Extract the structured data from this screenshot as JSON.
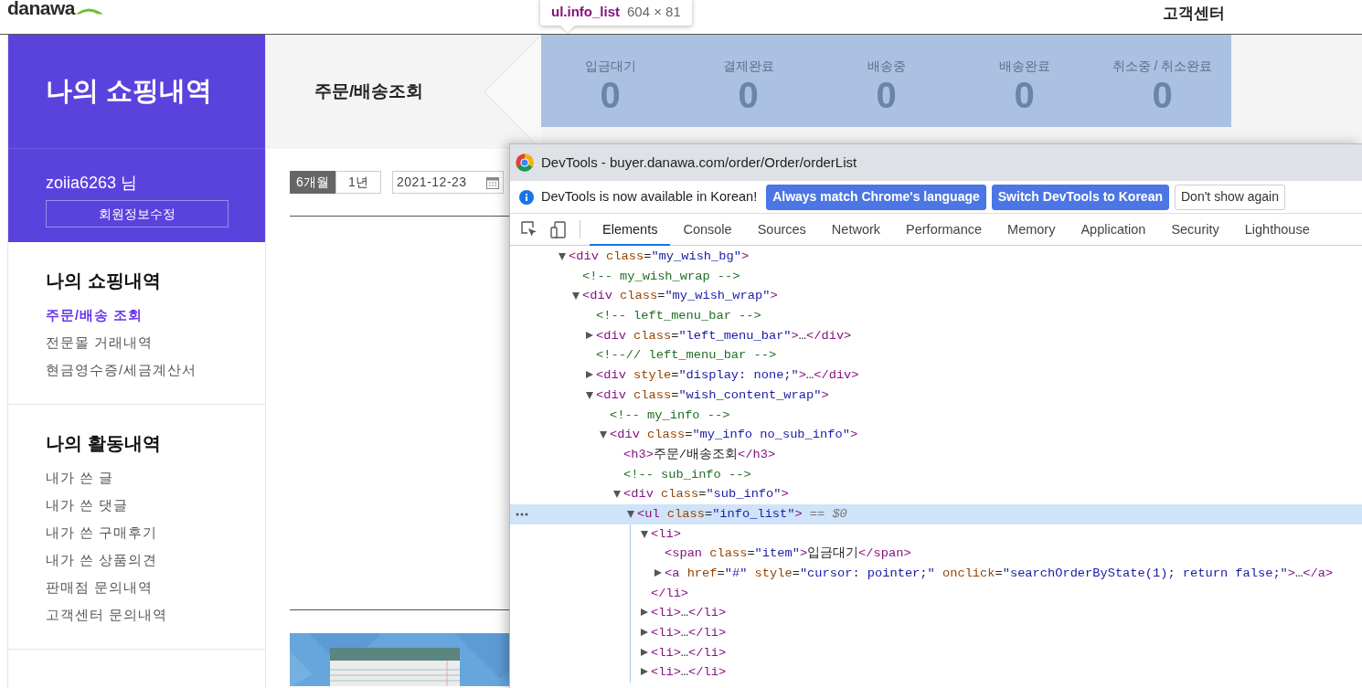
{
  "header": {
    "logo": "danawa",
    "link": "고객센터"
  },
  "tooltip": {
    "selector": "ul.info_list",
    "size": "604 × 81"
  },
  "sidebar": {
    "title": "나의 쇼핑내역",
    "user": "zoiia6263 님",
    "edit_button": "회원정보수정",
    "sections": [
      {
        "heading": "나의 쇼핑내역",
        "items": [
          {
            "label": "주문/배송 조회",
            "selected": true
          },
          {
            "label": "전문몰 거래내역",
            "selected": false
          },
          {
            "label": "현금영수증/세금계산서",
            "selected": false
          }
        ]
      },
      {
        "heading": "나의 활동내역",
        "items": [
          {
            "label": "내가 쓴 글",
            "selected": false
          },
          {
            "label": "내가 쓴 댓글",
            "selected": false
          },
          {
            "label": "내가 쓴 구매후기",
            "selected": false
          },
          {
            "label": "내가 쓴 상품의견",
            "selected": false
          },
          {
            "label": "판매점 문의내역",
            "selected": false
          },
          {
            "label": "고객센터 문의내역",
            "selected": false
          }
        ]
      }
    ]
  },
  "page": {
    "heading": "주문/배송조회",
    "status_list": {
      "highlighted": true,
      "items": [
        {
          "label": "입금대기",
          "count": "0"
        },
        {
          "label": "결제완료",
          "count": "0"
        },
        {
          "label": "배송중",
          "count": "0"
        },
        {
          "label": "배송완료",
          "count": "0"
        },
        {
          "label": "취소중 / 취소완료",
          "count": "0"
        }
      ]
    },
    "periods": [
      {
        "label": "6개월",
        "selected": true
      },
      {
        "label": "1년",
        "selected": false
      }
    ],
    "start_date": "2021-12-23"
  },
  "devtools": {
    "title": "DevTools - buyer.danawa.com/order/Order/orderList",
    "infobar": {
      "message": "DevTools is now available in Korean!",
      "buttons": [
        {
          "label": "Always match Chrome's language",
          "kind": "primary"
        },
        {
          "label": "Switch DevTools to Korean",
          "kind": "primary"
        },
        {
          "label": "Don't show again",
          "kind": "outline"
        }
      ]
    },
    "tabs": [
      {
        "label": "Elements",
        "selected": true
      },
      {
        "label": "Console",
        "selected": false
      },
      {
        "label": "Sources",
        "selected": false
      },
      {
        "label": "Network",
        "selected": false
      },
      {
        "label": "Performance",
        "selected": false
      },
      {
        "label": "Memory",
        "selected": false
      },
      {
        "label": "Application",
        "selected": false
      },
      {
        "label": "Security",
        "selected": false
      },
      {
        "label": "Lighthouse",
        "selected": false
      }
    ],
    "tree": [
      {
        "kind": "element",
        "text": "<div class=\"my_wish_bg\">",
        "expanded": true,
        "selected": false,
        "children": [
          {
            "kind": "comment",
            "text": "<!-- my_wish_wrap -->",
            "selected": false
          },
          {
            "kind": "element",
            "text": "<div class=\"my_wish_wrap\">",
            "expanded": true,
            "selected": false,
            "children": [
              {
                "kind": "comment",
                "text": "<!-- left_menu_bar -->",
                "selected": false
              },
              {
                "kind": "element",
                "text": "<div class=\"left_menu_bar\">…</div>",
                "expanded": false,
                "selected": false
              },
              {
                "kind": "comment",
                "text": "<!--// left_menu_bar -->",
                "selected": false
              },
              {
                "kind": "element",
                "text": "<div style=\"display: none;\">…</div>",
                "expanded": false,
                "selected": false
              },
              {
                "kind": "element",
                "text": "<div class=\"wish_content_wrap\">",
                "expanded": true,
                "selected": false,
                "children": [
                  {
                    "kind": "comment",
                    "text": "<!-- my_info -->",
                    "selected": false
                  },
                  {
                    "kind": "element",
                    "text": "<div class=\"my_info no_sub_info\">",
                    "expanded": true,
                    "selected": false,
                    "children": [
                      {
                        "kind": "leaf",
                        "text": "<h3>주문/배송조회</h3>",
                        "selected": false
                      },
                      {
                        "kind": "comment",
                        "text": "<!-- sub_info -->",
                        "selected": false
                      },
                      {
                        "kind": "element",
                        "text": "<div class=\"sub_info\">",
                        "expanded": true,
                        "selected": false,
                        "children": [
                          {
                            "kind": "element",
                            "text": "<ul class=\"info_list\">",
                            "suffix": "== $0",
                            "expanded": true,
                            "selected": true,
                            "children": [
                              {
                                "kind": "element",
                                "text": "<li>",
                                "expanded": true,
                                "selected": false,
                                "close": "</li>",
                                "children": [
                                  {
                                    "kind": "leaf",
                                    "text": "<span class=\"item\">입금대기</span>",
                                    "selected": false
                                  },
                                  {
                                    "kind": "element",
                                    "text": "<a href=\"#\" style=\"cursor: pointer;\" onclick=\"searchOrderByState(1); return false;\">…</a>",
                                    "expanded": false,
                                    "selected": false
                                  }
                                ]
                              },
                              {
                                "kind": "element",
                                "text": "<li>…</li>",
                                "expanded": false,
                                "selected": false
                              },
                              {
                                "kind": "element",
                                "text": "<li>…</li>",
                                "expanded": false,
                                "selected": false
                              },
                              {
                                "kind": "element",
                                "text": "<li>…</li>",
                                "expanded": false,
                                "selected": false
                              },
                              {
                                "kind": "element",
                                "text": "<li>…</li>",
                                "expanded": false,
                                "selected": false
                              }
                            ]
                          }
                        ]
                      }
                    ]
                  }
                ]
              }
            ]
          }
        ]
      }
    ]
  }
}
